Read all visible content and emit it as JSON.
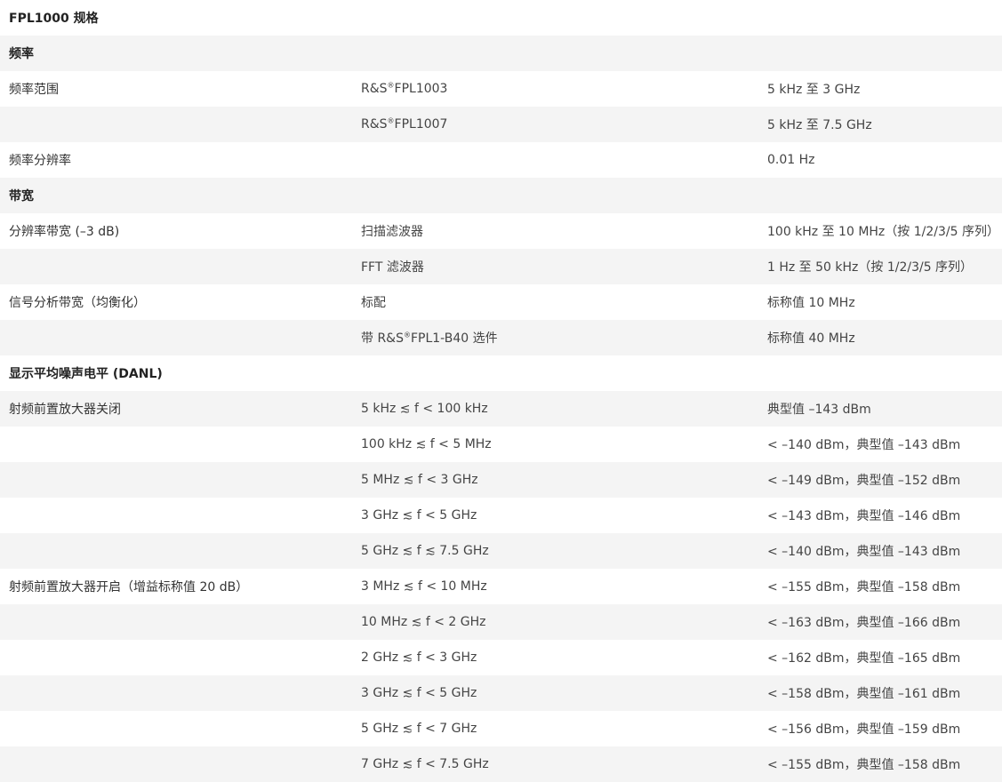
{
  "title": "FPL1000 规格",
  "sections": [
    {
      "heading": "频率",
      "rows": [
        {
          "label": "频率范围",
          "condition": "R&S®FPL1003",
          "value": "5 kHz 至 3 GHz"
        },
        {
          "label": "",
          "condition": "R&S®FPL1007",
          "value": "5 kHz 至 7.5 GHz"
        },
        {
          "label": "频率分辨率",
          "condition": "",
          "value": "0.01 Hz"
        }
      ]
    },
    {
      "heading": "带宽",
      "rows": [
        {
          "label": "分辨率带宽 (–3 dB)",
          "condition": "扫描滤波器",
          "value": "100 kHz 至 10 MHz（按 1/2/3/5 序列）"
        },
        {
          "label": "",
          "condition": "FFT 滤波器",
          "value": "1 Hz 至 50 kHz（按 1/2/3/5 序列）"
        },
        {
          "label": "信号分析带宽（均衡化）",
          "condition": "标配",
          "value": "标称值 10 MHz"
        },
        {
          "label": "",
          "condition": "带 R&S®FPL1-B40 选件",
          "value": "标称值 40 MHz"
        }
      ]
    },
    {
      "heading": "显示平均噪声电平 (DANL)",
      "rows": [
        {
          "label": "射频前置放大器关闭",
          "condition": "5 kHz ≲ f < 100 kHz",
          "value": "典型值 –143 dBm"
        },
        {
          "label": "",
          "condition": "100 kHz ≲ f < 5 MHz",
          "value": "< –140 dBm，典型值 –143 dBm"
        },
        {
          "label": "",
          "condition": "5 MHz ≲ f < 3 GHz",
          "value": "< –149 dBm，典型值 –152 dBm"
        },
        {
          "label": "",
          "condition": "3 GHz ≲ f < 5 GHz",
          "value": "< –143 dBm，典型值 –146 dBm"
        },
        {
          "label": "",
          "condition": "5 GHz ≲ f ≲ 7.5 GHz",
          "value": "< –140 dBm，典型值 –143 dBm"
        },
        {
          "label": "射频前置放大器开启（增益标称值 20 dB）",
          "condition": "3 MHz ≲ f < 10 MHz",
          "value": "< –155 dBm，典型值 –158 dBm"
        },
        {
          "label": "",
          "condition": "10 MHz ≲ f < 2 GHz",
          "value": "< –163 dBm，典型值 –166 dBm"
        },
        {
          "label": "",
          "condition": "2 GHz ≲ f < 3 GHz",
          "value": "< –162 dBm，典型值 –165 dBm"
        },
        {
          "label": "",
          "condition": "3 GHz ≲ f < 5 GHz",
          "value": "< –158 dBm，典型值 –161 dBm"
        },
        {
          "label": "",
          "condition": "5 GHz ≲ f < 7 GHz",
          "value": "< –156 dBm，典型值 –159 dBm"
        },
        {
          "label": "",
          "condition": "7 GHz ≲ f < 7.5 GHz",
          "value": "< –155 dBm，典型值 –158 dBm"
        }
      ]
    }
  ]
}
